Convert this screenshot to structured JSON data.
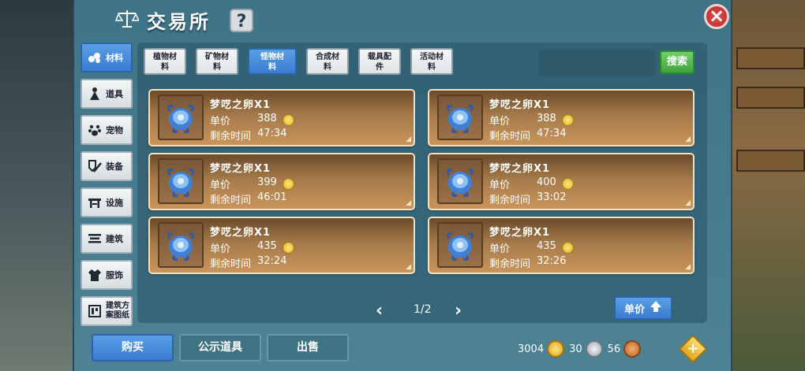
{
  "title": "交易所",
  "help_label": "?",
  "close_label": "×",
  "side_tabs": [
    {
      "label": "材料",
      "icon": "materials-icon",
      "active": true
    },
    {
      "label": "道具",
      "icon": "props-icon",
      "active": false
    },
    {
      "label": "宠物",
      "icon": "paw-icon",
      "active": false
    },
    {
      "label": "装备",
      "icon": "equipment-icon",
      "active": false
    },
    {
      "label": "设施",
      "icon": "facility-icon",
      "active": false
    },
    {
      "label": "建筑",
      "icon": "building-icon",
      "active": false
    },
    {
      "label": "服饰",
      "icon": "clothing-icon",
      "active": false
    },
    {
      "label": "建筑方案图纸",
      "line1": "建筑方",
      "line2": "案图纸",
      "icon": "blueprint-icon",
      "active": false
    }
  ],
  "category_tabs": [
    {
      "line1": "植物材",
      "line2": "料",
      "active": false
    },
    {
      "line1": "矿物材",
      "line2": "料",
      "active": false
    },
    {
      "line1": "怪物材",
      "line2": "料",
      "active": true
    },
    {
      "line1": "合成材",
      "line2": "料",
      "active": false
    },
    {
      "line1": "载具配",
      "line2": "件",
      "active": false
    },
    {
      "line1": "活动材",
      "line2": "料",
      "active": false
    }
  ],
  "search": {
    "placeholder": "",
    "button_label": "搜索"
  },
  "listings": [
    {
      "name": "梦呓之卵X1",
      "price_label": "单价",
      "price": "388",
      "time_label": "剩余时间",
      "time": "47:34"
    },
    {
      "name": "梦呓之卵X1",
      "price_label": "单价",
      "price": "388",
      "time_label": "剩余时间",
      "time": "47:34"
    },
    {
      "name": "梦呓之卵X1",
      "price_label": "单价",
      "price": "399",
      "time_label": "剩余时间",
      "time": "46:01"
    },
    {
      "name": "梦呓之卵X1",
      "price_label": "单价",
      "price": "400",
      "time_label": "剩余时间",
      "time": "33:02"
    },
    {
      "name": "梦呓之卵X1",
      "price_label": "单价",
      "price": "435",
      "time_label": "剩余时间",
      "time": "32:24"
    },
    {
      "name": "梦呓之卵X1",
      "price_label": "单价",
      "price": "435",
      "time_label": "剩余时间",
      "time": "32:26"
    }
  ],
  "pager": {
    "text": "1/2",
    "prev": "‹",
    "next": "›"
  },
  "sort_button": {
    "label": "单价"
  },
  "bottom_buttons": {
    "buy": "购买",
    "public_items": "公示道具",
    "sell": "出售"
  },
  "currency": {
    "gold": "3004",
    "silver": "30",
    "bronze": "56",
    "add": "+"
  },
  "colors": {
    "accent_blue": "#3a7bd0",
    "search_green": "#3fa43c",
    "close_red": "#c83838",
    "card_brown": "#a57a4a"
  }
}
